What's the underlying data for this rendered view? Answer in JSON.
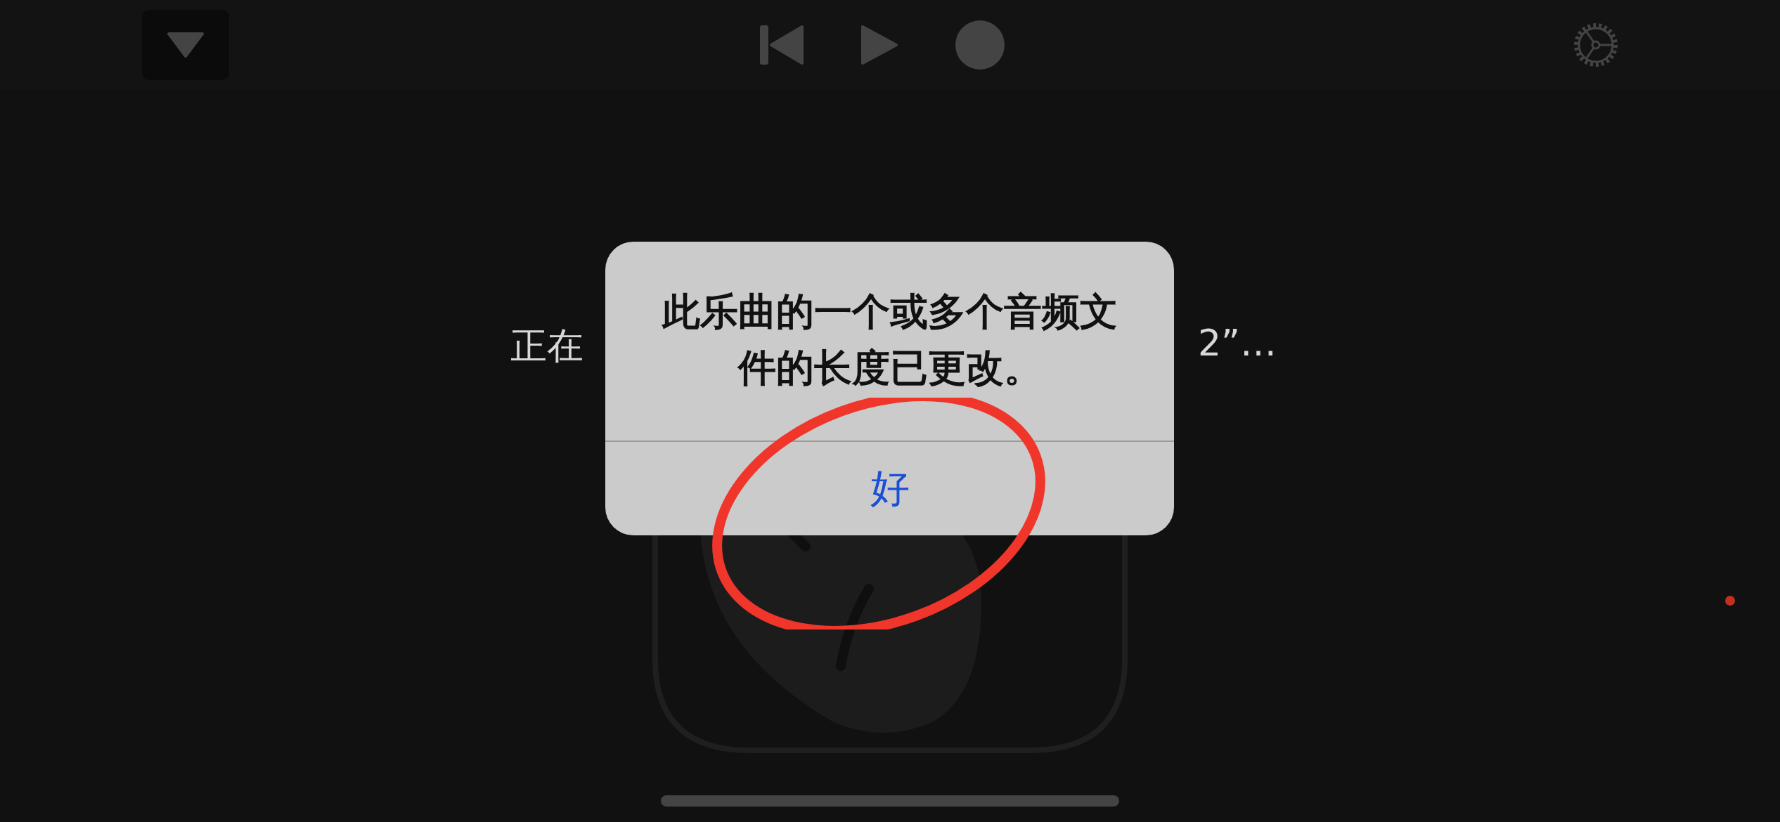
{
  "loading_text": {
    "visible_start": "正在",
    "visible_end": "2”…"
  },
  "alert": {
    "message": "此乐曲的一个或多个音频文件的长度已更改。",
    "buttons": [
      "好"
    ]
  }
}
